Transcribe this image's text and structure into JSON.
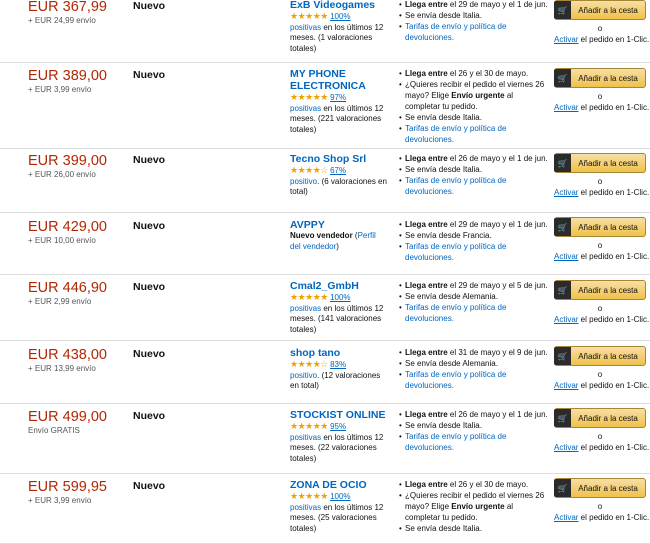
{
  "labels": {
    "add_to_cart": "Añadir a la cesta",
    "or": "o",
    "activate": "Activar",
    "one_click_suffix": " el pedido en 1-Clic.",
    "positive": "positivas",
    "positive_single": "positivo",
    "arrives_prefix": "Llega entre",
    "shipping_policy": "Tarifas de envío y política de devoluciones."
  },
  "icons": {
    "cart": "cart-icon",
    "star": "star-icon"
  },
  "colors": {
    "price": "#b12704",
    "link": "#0066c0",
    "star": "#f0a000",
    "button": "#f0c14b"
  },
  "offers": [
    {
      "price": "EUR 367,99",
      "shipping": "+ EUR 24,99 envío",
      "condition": "Nuevo",
      "seller": "ExB Videogames",
      "stars": "★★★★★",
      "percent": "100%",
      "rating_pre": "positivas",
      "rating_post": " en los últimos 12 meses. (1 valoraciones totales)",
      "delivery": [
        {
          "bold": "Llega entre",
          "text": " el 29 de mayo y el 1 de jun."
        },
        {
          "text": "Se envía desde Italia."
        },
        {
          "link": "Tarifas de envío y política de devoluciones."
        }
      ]
    },
    {
      "price": "EUR 389,00",
      "shipping": "+ EUR 3,99 envío",
      "condition": "Nuevo",
      "seller": "MY PHONE ELECTRONICA",
      "stars": "★★★★★",
      "percent": "97%",
      "rating_pre": "positivas",
      "rating_post": " en los últimos 12 meses. (221 valoraciones totales)",
      "delivery": [
        {
          "bold": "Llega entre",
          "text": " el 26 y el 30 de mayo."
        },
        {
          "text": "¿Quieres recibir el pedido el viernes 26 mayo? Elige ",
          "bold2": "Envío urgente",
          "text2": " al completar tu pedido."
        },
        {
          "text": "Se envía desde Italia."
        },
        {
          "link": "Tarifas de envío y política de devoluciones."
        }
      ]
    },
    {
      "price": "EUR 399,00",
      "shipping": "+ EUR 26,00 envío",
      "condition": "Nuevo",
      "seller": "Tecno Shop Srl",
      "stars": "★★★★☆",
      "percent": "67%",
      "rating_pre": "positivo",
      "rating_post": ". (6 valoraciones en total)",
      "delivery": [
        {
          "bold": "Llega entre",
          "text": " el 26 de mayo y el 1 de jun."
        },
        {
          "text": "Se envía desde Italia."
        },
        {
          "link": "Tarifas de envío y política de devoluciones."
        }
      ]
    },
    {
      "price": "EUR 429,00",
      "shipping": "+ EUR 10,00 envío",
      "condition": "Nuevo",
      "seller": "AVPPY",
      "new_seller": "Nuevo vendedor",
      "profile_link": "Perfil del vendedor",
      "delivery": [
        {
          "bold": "Llega entre",
          "text": " el 29 de mayo y el 1 de jun."
        },
        {
          "text": "Se envía desde Francia."
        },
        {
          "link": "Tarifas de envío y política de devoluciones."
        }
      ]
    },
    {
      "price": "EUR 446,90",
      "shipping": "+ EUR 2,99 envío",
      "condition": "Nuevo",
      "seller": "Cmal2_GmbH",
      "stars": "★★★★★",
      "percent": "100%",
      "rating_pre": "positivas",
      "rating_post": " en los últimos 12 meses. (141 valoraciones totales)",
      "delivery": [
        {
          "bold": "Llega entre",
          "text": " el 29 de mayo y el 5 de jun."
        },
        {
          "text": "Se envía desde Alemania."
        },
        {
          "link": "Tarifas de envío y política de devoluciones."
        }
      ]
    },
    {
      "price": "EUR 438,00",
      "shipping": "+ EUR 13,99 envío",
      "condition": "Nuevo",
      "seller": "shop tano",
      "stars": "★★★★☆",
      "percent": "83%",
      "rating_pre": "positivo",
      "rating_post": ". (12 valoraciones en total)",
      "delivery": [
        {
          "bold": "Llega entre",
          "text": " el 31 de mayo y el 9 de jun."
        },
        {
          "text": "Se envía desde Alemania."
        },
        {
          "link": "Tarifas de envío y política de devoluciones."
        }
      ]
    },
    {
      "price": "EUR 499,00",
      "shipping": "Envío GRATIS",
      "condition": "Nuevo",
      "seller": "STOCKIST ONLINE",
      "stars": "★★★★★",
      "percent": "95%",
      "rating_pre": "positivas",
      "rating_post": " en los últimos 12 meses. (22 valoraciones totales)",
      "delivery": [
        {
          "bold": "Llega entre",
          "text": " el 26 de mayo y el 1 de jun."
        },
        {
          "text": "Se envía desde Italia."
        },
        {
          "link": "Tarifas de envío y política de devoluciones."
        }
      ]
    },
    {
      "price": "EUR 599,95",
      "shipping": "+ EUR 3,99 envío",
      "condition": "Nuevo",
      "seller": "ZONA DE OCIO",
      "stars": "★★★★★",
      "percent": "100%",
      "rating_pre": "positivas",
      "rating_post": " en los últimos 12 meses. (25 valoraciones totales)",
      "delivery": [
        {
          "bold": "Llega entre",
          "text": " el 26 y el 30 de mayo."
        },
        {
          "text": "¿Quieres recibir el pedido el viernes 26 mayo? Elige ",
          "bold2": "Envío urgente",
          "text2": " al completar tu pedido."
        },
        {
          "text": "Se envía desde Italia."
        }
      ]
    }
  ]
}
